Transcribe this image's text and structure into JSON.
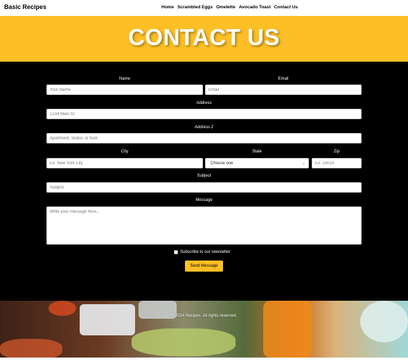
{
  "nav": {
    "brand": "Basic Recipes",
    "links": [
      "Home",
      "Scrambled Eggs",
      "Omelette",
      "Avocado Toast",
      "Contact Us"
    ]
  },
  "hero": {
    "title": "CONTACT US"
  },
  "form": {
    "name": {
      "label": "Name",
      "placeholder": "Your Name"
    },
    "email": {
      "label": "Email",
      "placeholder": "Email"
    },
    "address": {
      "label": "Address",
      "placeholder": "1234 Main St"
    },
    "address2": {
      "label": "Address 2",
      "placeholder": "Apartment, studio, or floor"
    },
    "city": {
      "label": "City",
      "placeholder": "Ex: New York City"
    },
    "state": {
      "label": "State",
      "selected": "Choose one"
    },
    "zip": {
      "label": "Zip",
      "placeholder": "Ex: 10019"
    },
    "subject": {
      "label": "Subject",
      "placeholder": "Subject"
    },
    "message": {
      "label": "Message",
      "placeholder": "Write your message here..."
    },
    "subscribe_label": "Subscribe to our newsletter",
    "send_label": "Send Message"
  },
  "footer": {
    "text": "© 2024 Recipes. All rights reserved."
  },
  "colors": {
    "accent": "#fcbf25",
    "background": "#000000",
    "nav_bg": "#ffffff"
  },
  "icons": {
    "state_select": "chevron-down-icon"
  }
}
